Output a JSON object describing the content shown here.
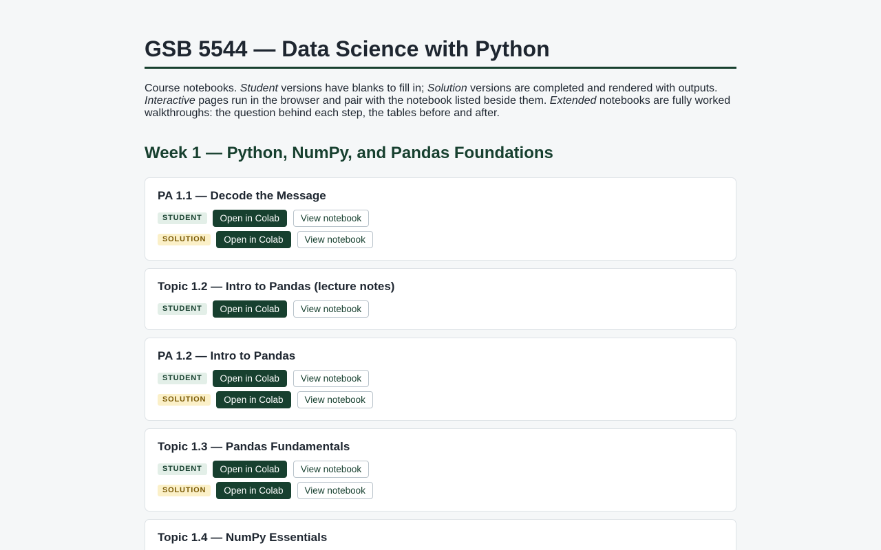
{
  "page": {
    "title": "GSB 5544 — Data Science with Python"
  },
  "intro": {
    "p1": "Course notebooks. ",
    "student_em": "Student",
    "p2": " versions have blanks to fill in; ",
    "solution_em": "Solution",
    "p3": " versions are completed and rendered with outputs. ",
    "interactive_em": "Interactive",
    "p4": " pages run in the browser and pair with the notebook listed beside them. ",
    "extended_em": "Extended",
    "p5": " notebooks are fully worked walkthroughs: the question behind each step, the tables before and after."
  },
  "week1": {
    "heading": "Week 1 — Python, NumPy, and Pandas Foundations",
    "labels": {
      "student": "STUDENT",
      "solution": "SOLUTION",
      "colab": "Open in Colab",
      "view": "View notebook"
    },
    "cards": [
      {
        "title": "PA 1.1 — Decode the Message"
      },
      {
        "title": "Topic 1.2 — Intro to Pandas (lecture notes)"
      },
      {
        "title": "PA 1.2 — Intro to Pandas"
      },
      {
        "title": "Topic 1.3 — Pandas Fundamentals"
      },
      {
        "title": "Topic 1.4 — NumPy Essentials"
      }
    ]
  },
  "colors": {
    "accent": "#17402f",
    "student_badge_bg": "#e3efe8",
    "solution_badge_bg": "#fbf0c8"
  }
}
